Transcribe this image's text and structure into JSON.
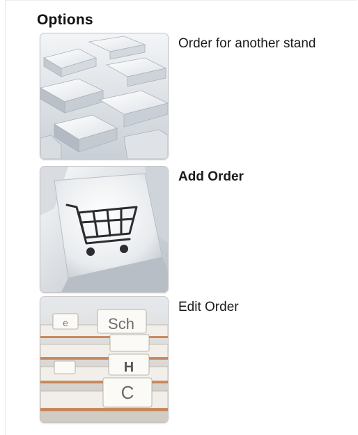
{
  "options_panel": {
    "heading": "Options",
    "items": [
      {
        "label": "Order for another stand",
        "emphasis": "normal",
        "image": "blocks-image"
      },
      {
        "label": "Add Order",
        "emphasis": "bold",
        "image": "shopping-cart-key-image"
      },
      {
        "label": "Edit Order",
        "emphasis": "normal",
        "image": "file-index-cards-image"
      }
    ],
    "index_tab_letters": [
      "Sch",
      "e",
      "H",
      "C"
    ]
  }
}
